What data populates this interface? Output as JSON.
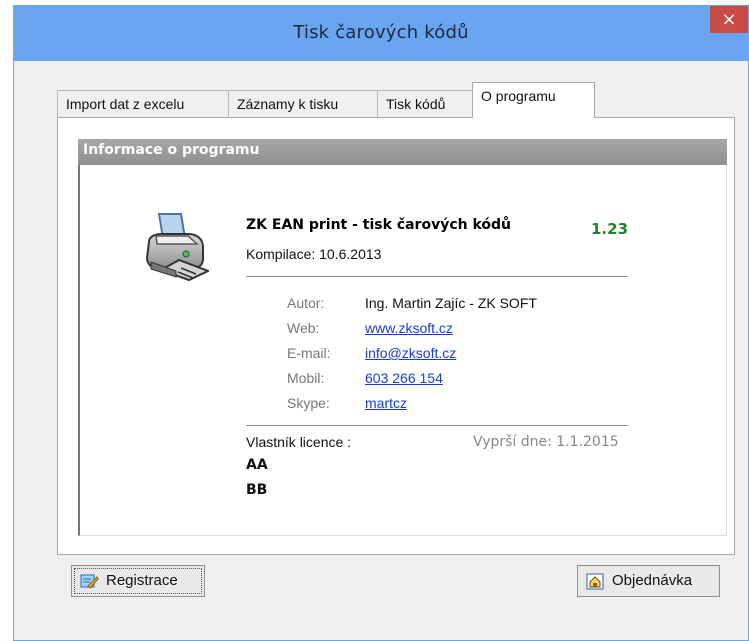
{
  "window": {
    "title": "Tisk čarových kódů",
    "close_symbol": "×"
  },
  "tabs": [
    {
      "label": "Import dat z excelu",
      "active": false
    },
    {
      "label": "Záznamy k tisku",
      "active": false
    },
    {
      "label": "Tisk kódů",
      "active": false
    },
    {
      "label": "O programu",
      "active": true
    }
  ],
  "info": {
    "section_title": "Informace o programu",
    "app_name": "ZK EAN print - tisk čarových kódů",
    "version": "1.23",
    "build": "Kompilace: 10.6.2013",
    "author_label": "Autor:",
    "author_value": "Ing. Martin Zajíc - ZK SOFT",
    "web_label": "Web:",
    "web_value": "www.zksoft.cz",
    "email_label": "E-mail:",
    "email_value": "info@zksoft.cz",
    "mobile_label": "Mobil:",
    "mobile_value": "603 266 154",
    "skype_label": "Skype:",
    "skype_value": "martcz",
    "owner_label": "Vlastník licence :",
    "expires": "Vyprší dne: 1.1.2015",
    "owner_lines": [
      "AA",
      "BB"
    ]
  },
  "buttons": {
    "registration": "Registrace",
    "order": "Objednávka"
  },
  "icons": {
    "printer": "printer-icon",
    "registration": "registration-icon",
    "order": "order-icon",
    "close": "close-icon"
  },
  "colors": {
    "title_bar": "#69a5f0",
    "close_button": "#c94b45",
    "version": "#25822b",
    "link": "#1a3bd7"
  }
}
